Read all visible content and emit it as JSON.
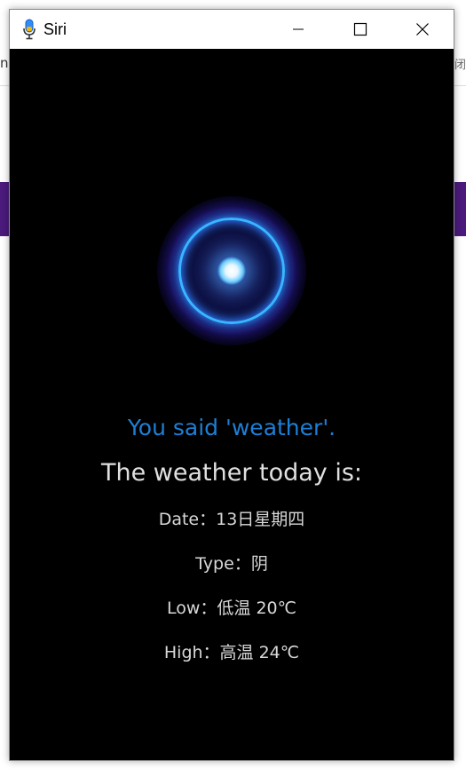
{
  "background_app": {
    "left_fragment": "ng",
    "right_fragment": "闭"
  },
  "window": {
    "title": "Siri",
    "icon": "microphone-icon",
    "controls": {
      "minimize": "minimize-icon",
      "maximize": "maximize-icon",
      "close": "close-icon"
    }
  },
  "siri": {
    "orb_colors": {
      "ring": "#38b6ff",
      "core": "#ffffff",
      "glow": "#3c28dc"
    },
    "you_said": "You said 'weather'.",
    "heading": "The weather today is:",
    "date_label": "Date：",
    "date_value": "13日星期四",
    "type_label": "Type：",
    "type_value": "阴",
    "low_label": "Low：",
    "low_value": "低温 20℃",
    "high_label": "High：",
    "high_value": "高温 24℃"
  },
  "colors": {
    "accent_text": "#1e7fd6",
    "background": "#000000"
  }
}
